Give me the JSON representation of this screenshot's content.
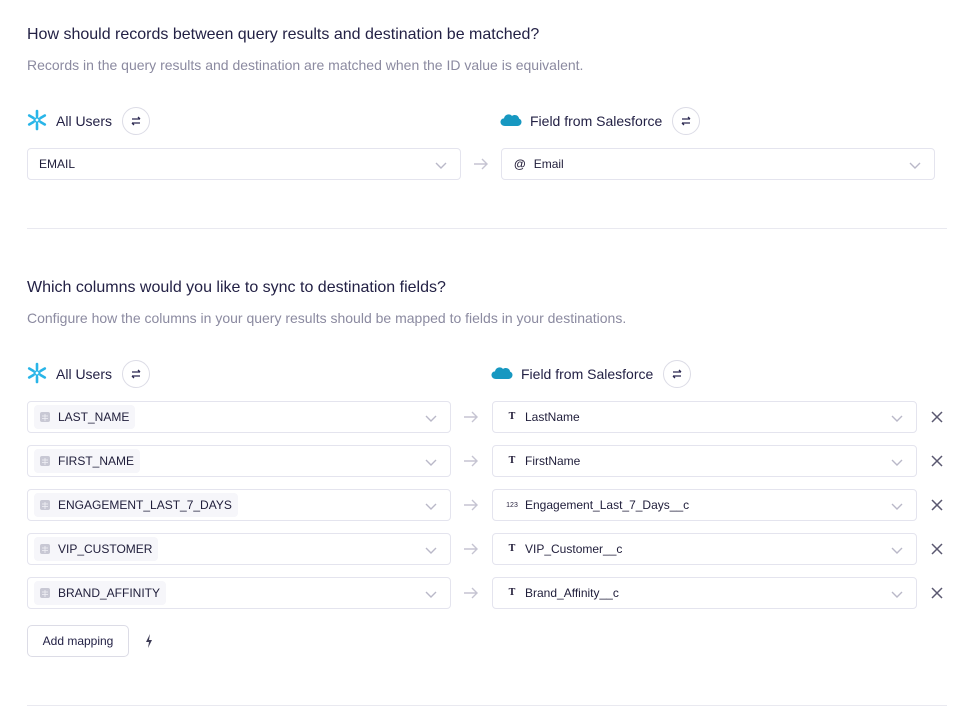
{
  "matching": {
    "title": "How should records between query results and destination be matched?",
    "description": "Records in the query results and destination are matched when the ID value is equivalent.",
    "source_header": {
      "icon": "snowflake-icon",
      "label": "All Users"
    },
    "dest_header": {
      "icon": "salesforce-icon",
      "label": "Field from Salesforce"
    },
    "source_value": "EMAIL",
    "dest_value": "Email",
    "dest_type_icon": "at-sign-icon"
  },
  "mappings": {
    "title": "Which columns would you like to sync to destination fields?",
    "description": "Configure how the columns in your query results should be mapped to fields in your destinations.",
    "source_header": {
      "icon": "snowflake-icon",
      "label": "All Users"
    },
    "dest_header": {
      "icon": "salesforce-icon",
      "label": "Field from Salesforce"
    },
    "rows": [
      {
        "source": "LAST_NAME",
        "dest": "LastName",
        "dest_type": "T"
      },
      {
        "source": "FIRST_NAME",
        "dest": "FirstName",
        "dest_type": "T"
      },
      {
        "source": "ENGAGEMENT_LAST_7_DAYS",
        "dest": "Engagement_Last_7_Days__c",
        "dest_type": "123"
      },
      {
        "source": "VIP_CUSTOMER",
        "dest": "VIP_Customer__c",
        "dest_type": "T"
      },
      {
        "source": "BRAND_AFFINITY",
        "dest": "Brand_Affinity__c",
        "dest_type": "T"
      }
    ],
    "add_mapping_label": "Add mapping"
  }
}
